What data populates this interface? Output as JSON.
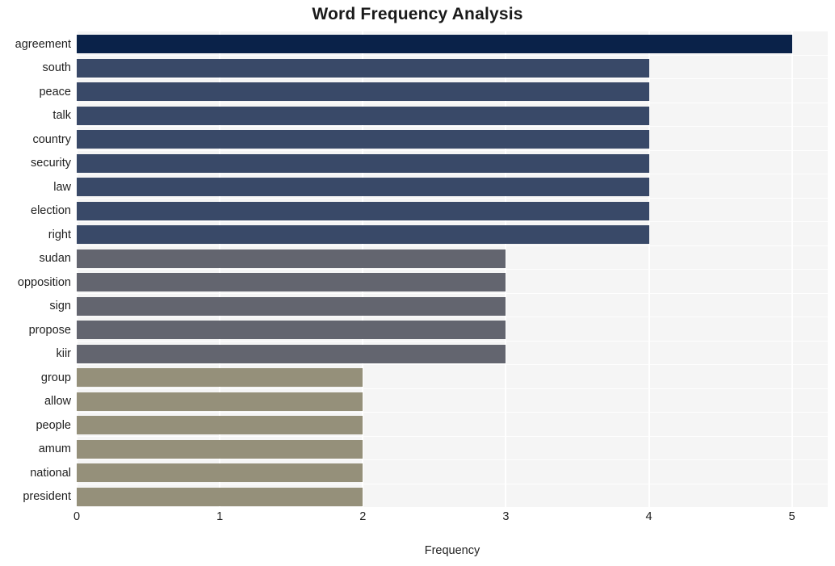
{
  "chart_data": {
    "type": "bar",
    "orientation": "horizontal",
    "title": "Word Frequency Analysis",
    "xlabel": "Frequency",
    "ylabel": "",
    "categories": [
      "agreement",
      "south",
      "peace",
      "talk",
      "country",
      "security",
      "law",
      "election",
      "right",
      "sudan",
      "opposition",
      "sign",
      "propose",
      "kiir",
      "group",
      "allow",
      "people",
      "amum",
      "national",
      "president"
    ],
    "values": [
      5,
      4,
      4,
      4,
      4,
      4,
      4,
      4,
      4,
      3,
      3,
      3,
      3,
      3,
      2,
      2,
      2,
      2,
      2,
      2
    ],
    "bar_colors": [
      "#0a2249",
      "#394968",
      "#394968",
      "#394968",
      "#394968",
      "#394968",
      "#394968",
      "#394968",
      "#394968",
      "#63656f",
      "#63656f",
      "#63656f",
      "#63656f",
      "#63656f",
      "#95907a",
      "#95907a",
      "#95907a",
      "#95907a",
      "#95907a",
      "#95907a"
    ],
    "xlim": [
      0,
      5.25
    ],
    "xticks": [
      0,
      1,
      2,
      3,
      4,
      5
    ],
    "xtick_labels": [
      "0",
      "1",
      "2",
      "3",
      "4",
      "5"
    ],
    "grid": true,
    "grid_color": "#ffffff",
    "plot_background": "#f5f5f5",
    "figure_background": "#ffffff",
    "legend": null,
    "legend_position": "none"
  },
  "style": {
    "title_color": "#1a1a1a",
    "tick_color": "#1f1f1f",
    "axis_label_color": "#1f1f1f"
  }
}
